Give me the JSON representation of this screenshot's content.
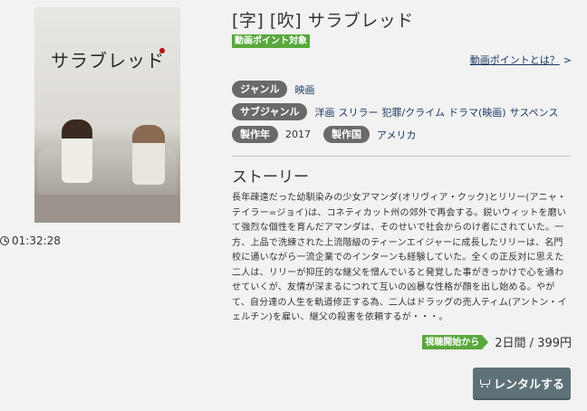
{
  "poster": {
    "title_text": "サラブレッド",
    "alt": "サラブレッド"
  },
  "runtime": "01:32:28",
  "title": "[字] [吹] サラブレッド",
  "point_badge": "動画ポイント対象",
  "point_link": {
    "label": "動画ポイントとは？",
    "chevron": ">"
  },
  "meta": {
    "genre": {
      "label": "ジャンル",
      "value": "映画"
    },
    "subgenre": {
      "label": "サブジャンル",
      "values": [
        "洋画",
        "スリラー",
        "犯罪/クライム",
        "ドラマ(映画)",
        "サスペンス"
      ]
    },
    "year": {
      "label": "製作年",
      "value": "2017"
    },
    "country": {
      "label": "製作国",
      "value": "アメリカ"
    }
  },
  "story": {
    "heading": "ストーリー",
    "text": "長年疎遠だった幼馴染みの少女アマンダ(オリヴィア・クック)とリリー(アニャ・テイラー=ジョイ)は、コネティカット州の郊外で再会する。鋭いウィットを磨いて強烈な個性を育んだアマンダは、そのせいで社会からのけ者にされていた。一方、上品で洗練された上流階級のティーンエイジャーに成長したリリーは、名門校に通いながら一流企業でのインターンも経験していた。全くの正反対に思えた二人は、リリーが抑圧的な継父を憎んでいると発覚した事がきっかけで心を通わせていくが、友情が深まるにつれて互いの凶暴な性格が顔を出し始める。やがて、自分達の人生を軌道修正する為、二人はドラッグの売人ティム(アントン・イェルチン)を雇い、継父の殺害を依頼するが・・・。"
  },
  "rental": {
    "badge": "視聴開始から",
    "price": "2日間 / 399円",
    "button_label": "レンタルする"
  },
  "colors": {
    "accent_green": "#58a83c",
    "pill_gray": "#6a6a6a",
    "button": "#5e7178",
    "link": "#1c3a63"
  }
}
